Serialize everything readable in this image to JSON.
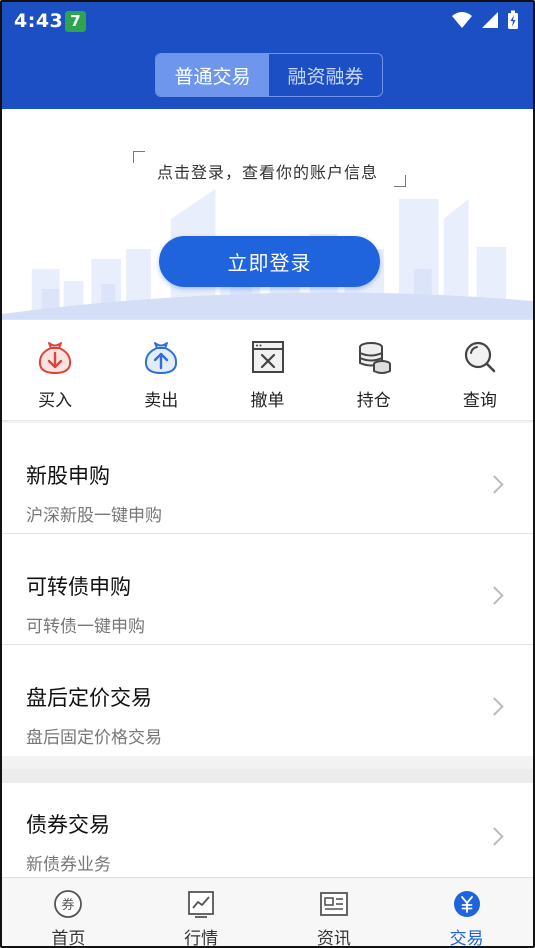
{
  "status_bar": {
    "time": "4:43",
    "badge": "7"
  },
  "header": {
    "tabs": [
      {
        "label": "普通交易",
        "active": true
      },
      {
        "label": "融资融券",
        "active": false
      }
    ]
  },
  "login": {
    "hint": "点击登录，查看你的账户信息",
    "button_label": "立即登录"
  },
  "actions": [
    {
      "label": "买入",
      "icon": "buy-icon"
    },
    {
      "label": "卖出",
      "icon": "sell-icon"
    },
    {
      "label": "撤单",
      "icon": "cancel-order-icon"
    },
    {
      "label": "持仓",
      "icon": "holdings-icon"
    },
    {
      "label": "查询",
      "icon": "search-icon"
    }
  ],
  "list": [
    {
      "title": "新股申购",
      "subtitle": "沪深新股一键申购"
    },
    {
      "title": "可转债申购",
      "subtitle": "可转债一键申购"
    },
    {
      "title": "盘后定价交易",
      "subtitle": "盘后固定价格交易"
    }
  ],
  "bond": {
    "title": "债券交易",
    "subtitle": "新债券业务"
  },
  "bottom_nav": [
    {
      "label": "首页",
      "icon": "home-coupon-icon",
      "active": false
    },
    {
      "label": "行情",
      "icon": "market-chart-icon",
      "active": false
    },
    {
      "label": "资讯",
      "icon": "news-icon",
      "active": false
    },
    {
      "label": "交易",
      "icon": "trade-yen-icon",
      "active": true
    }
  ],
  "colors": {
    "header": "#1c4fc4",
    "accent": "#1f63dd",
    "sell_blue": "#2f6fd8",
    "buy_red": "#e0413b"
  }
}
